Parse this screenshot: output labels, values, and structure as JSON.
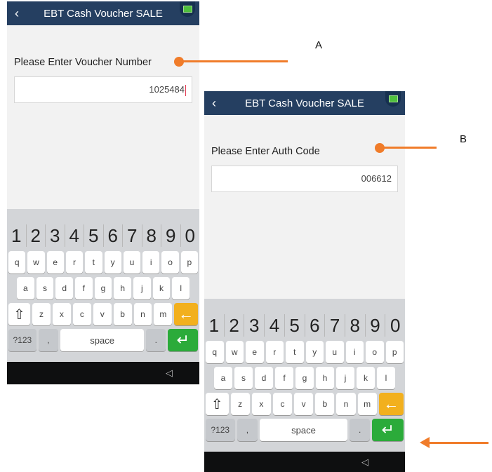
{
  "screen_a": {
    "title": "EBT Cash Voucher SALE",
    "prompt": "Please Enter Voucher Number",
    "field_value": "1025484"
  },
  "screen_b": {
    "title": "EBT Cash Voucher SALE",
    "prompt": "Please Enter Auth Code",
    "field_value": "006612"
  },
  "keyboard": {
    "numbers": [
      "1",
      "2",
      "3",
      "4",
      "5",
      "6",
      "7",
      "8",
      "9",
      "0"
    ],
    "row1": [
      "q",
      "w",
      "e",
      "r",
      "t",
      "y",
      "u",
      "i",
      "o",
      "p"
    ],
    "row2": [
      "a",
      "s",
      "d",
      "f",
      "g",
      "h",
      "j",
      "k",
      "l"
    ],
    "row3": [
      "z",
      "x",
      "c",
      "v",
      "b",
      "n",
      "m"
    ],
    "symbols_label": "?123",
    "comma_label": ",",
    "space_label": "space",
    "period_label": "."
  },
  "annotations": {
    "label_a": "A",
    "label_b": "B"
  },
  "colors": {
    "titlebar": "#253f61",
    "accent_orange": "#f07c2a",
    "backspace_key": "#f2b01e",
    "enter_key": "#2bab3a"
  },
  "icons": {
    "back": "chevron-left-icon",
    "corner": "terminal-icon",
    "shift": "shift-icon",
    "backspace": "backspace-arrow-icon",
    "enter": "enter-icon",
    "nav_back": "triangle-back-icon"
  }
}
